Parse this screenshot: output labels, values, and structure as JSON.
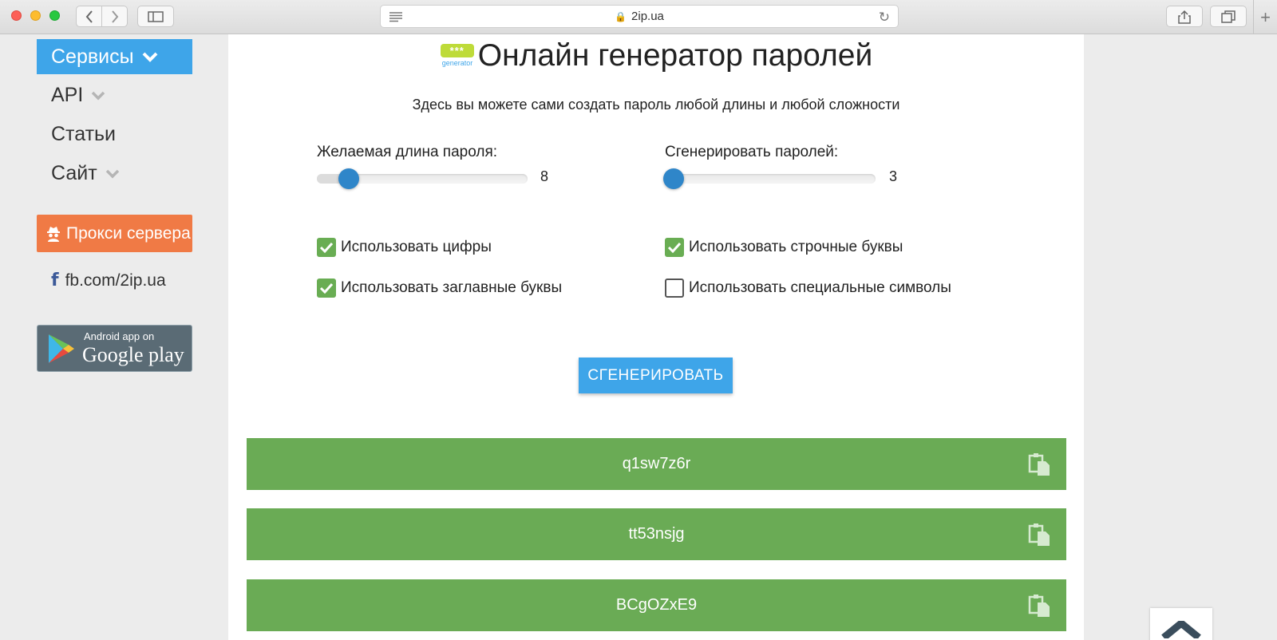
{
  "browser": {
    "url": "2ip.ua"
  },
  "sidebar": {
    "menu": [
      {
        "label": "Сервисы"
      },
      {
        "label": "API"
      },
      {
        "label": "Статьи"
      },
      {
        "label": "Сайт"
      }
    ],
    "proxy_label": "Прокси сервера",
    "fb_link": "fb.com/2ip.ua",
    "gplay_small": "Android app on",
    "gplay_big": "Google play"
  },
  "main": {
    "logo_text": "generator",
    "logo_stars": "***",
    "title": "Онлайн генератор паролей",
    "subtitle": "Здесь вы можете сами создать пароль любой длины и любой сложности",
    "length_slider": {
      "label": "Желаемая длина пароля:",
      "value": "8",
      "fraction": 0.15
    },
    "count_slider": {
      "label": "Сгенерировать паролей:",
      "value": "3",
      "fraction": 0.04
    },
    "options": [
      {
        "label": "Использовать цифры",
        "checked": true
      },
      {
        "label": "Использовать строчные буквы",
        "checked": true
      },
      {
        "label": "Использовать заглавные буквы",
        "checked": true
      },
      {
        "label": "Использовать специальные символы",
        "checked": false
      }
    ],
    "generate_label": "СГЕНЕРИРОВАТЬ",
    "passwords": [
      "q1sw7z6r",
      "tt53nsjg",
      "BCgOZxE9"
    ]
  },
  "colors": {
    "accent": "#3ea5e9",
    "proxy": "#f07a45",
    "password_bg": "#6aab55",
    "checkbox": "#69ad53",
    "slider_thumb": "#2f86c9"
  }
}
